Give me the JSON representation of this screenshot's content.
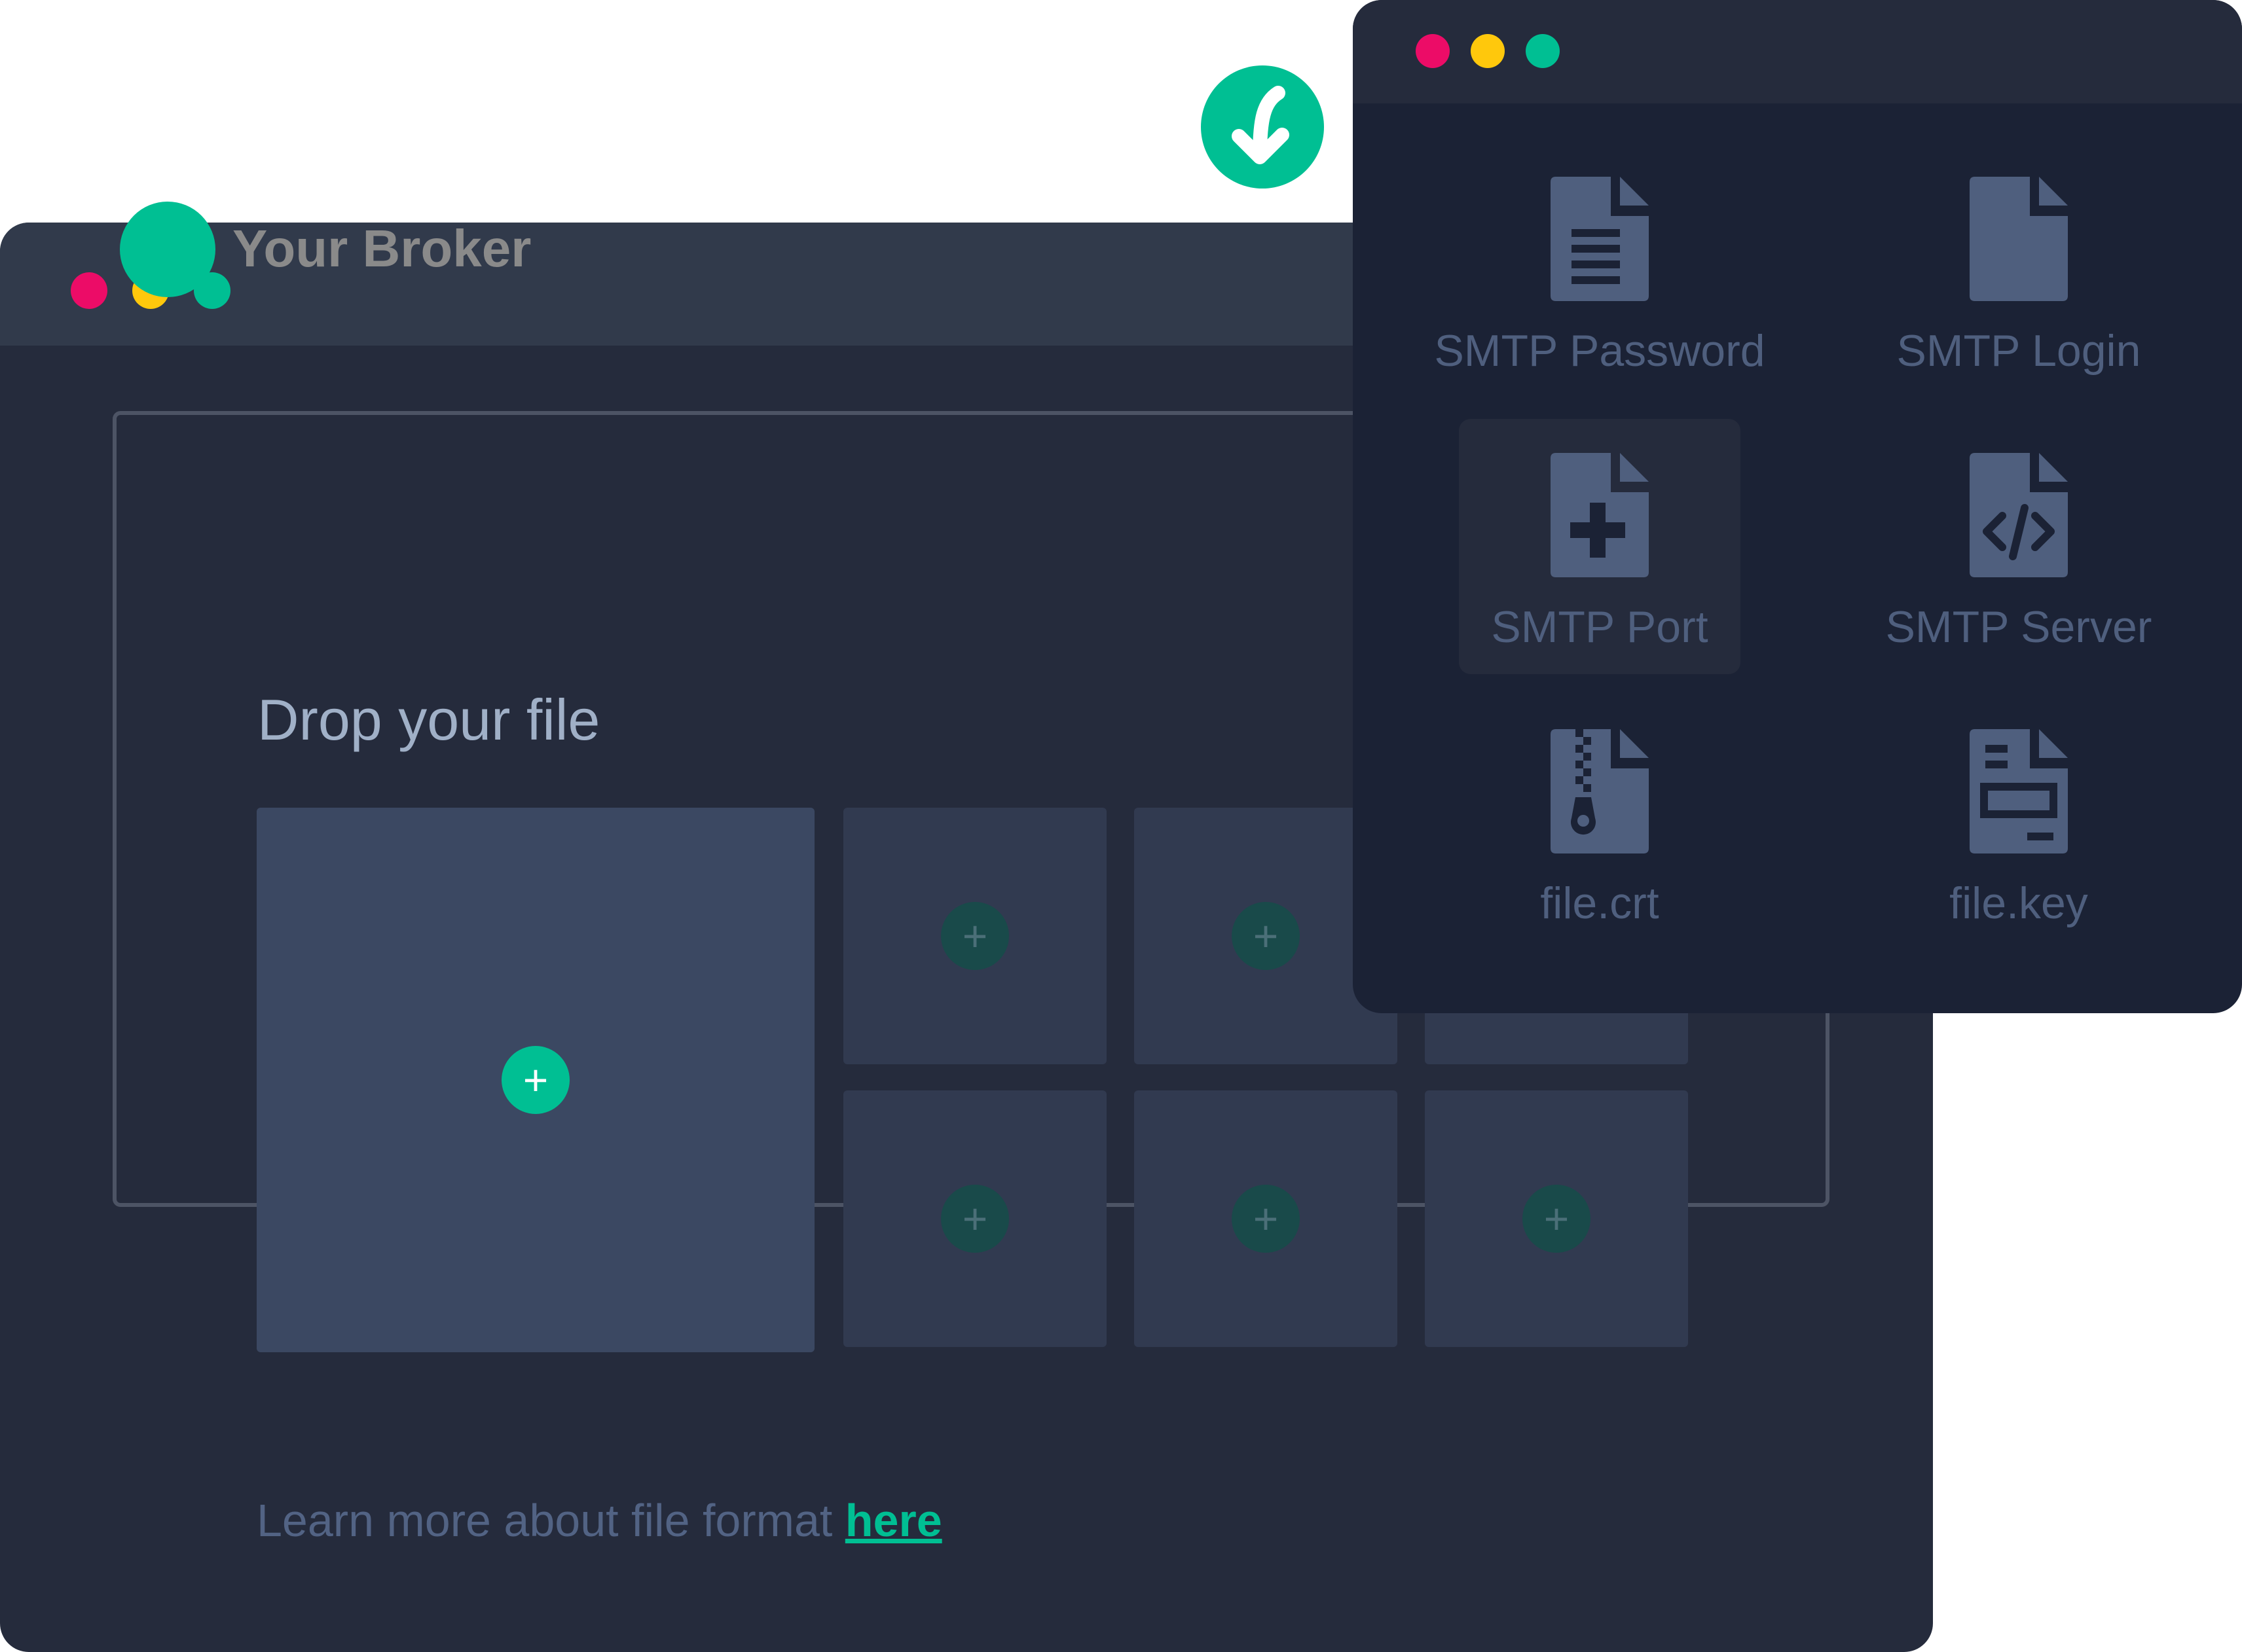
{
  "brand": {
    "name": "Your Broker"
  },
  "upload": {
    "title": "Drop your file",
    "add_symbol": "+",
    "learn_more_text": "Learn more about file format ",
    "learn_more_link": "here"
  },
  "file_panel": {
    "items": [
      {
        "label": "SMTP Password",
        "icon": "document-lines-icon",
        "selected": false
      },
      {
        "label": "SMTP Login",
        "icon": "document-blank-icon",
        "selected": false
      },
      {
        "label": "SMTP Port",
        "icon": "document-plus-icon",
        "selected": true
      },
      {
        "label": "SMTP Server",
        "icon": "document-code-icon",
        "selected": false
      },
      {
        "label": "file.crt",
        "icon": "document-zip-icon",
        "selected": false
      },
      {
        "label": "file.key",
        "icon": "document-key-icon",
        "selected": false
      }
    ]
  },
  "colors": {
    "accent": "#00bf93",
    "window_bg": "#252b3c",
    "panel_bg": "#1b2235",
    "icon_color": "#4f5f7e",
    "dot_red": "#ec0c67",
    "dot_yellow": "#ffc80c",
    "dot_green": "#00bf93"
  }
}
